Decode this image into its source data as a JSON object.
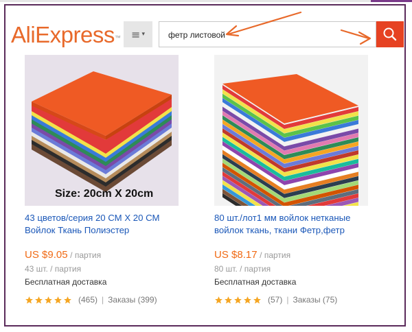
{
  "header": {
    "logo_text": "AliExpress",
    "logo_tm": "™",
    "menu_icon": "hamburger-menu-icon",
    "search_query": "фетр листовой",
    "search_icon": "magnifier-icon"
  },
  "colors": {
    "brand": "#e8692a",
    "search_button": "#e64222",
    "link": "#1a57b8",
    "price": "#f06a14",
    "star": "#f5a623",
    "arrow": "#e8692a",
    "frame": "#5a2a5a"
  },
  "products": [
    {
      "image_caption": "Size: 20cm X 20cm",
      "title": "43 цветов/серия 20 СМ Х 20 СМ Войлок Ткань Полиэстер",
      "price": "US $9.05",
      "price_unit": "/ партия",
      "quantity": "43 шт. / партия",
      "shipping": "Бесплатная доставка",
      "stars": 5,
      "reviews": "(465)",
      "orders": "Заказы (399)"
    },
    {
      "image_caption": "",
      "title": "80 шт./лот1 мм войлок нетканые войлок ткань, ткани Фетр,фетр",
      "price": "US $8.17",
      "price_unit": "/ партия",
      "quantity": "80 шт. / партия",
      "shipping": "Бесплатная доставка",
      "stars": 5,
      "reviews": "(57)",
      "orders": "Заказы (75)"
    }
  ]
}
